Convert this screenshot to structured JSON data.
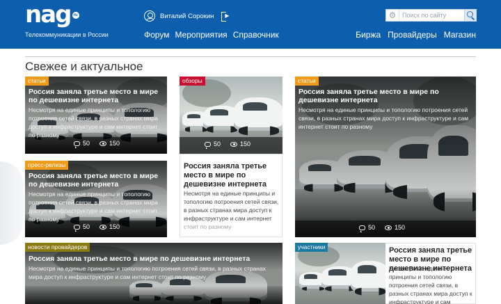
{
  "header": {
    "logo_text": "nag",
    "logo_badge": "ru",
    "tagline": "Телекоммуникации в России",
    "user_name": "Виталий Сорокин",
    "nav_left": [
      "Форум",
      "Мероприятия",
      "Справочник"
    ],
    "nav_right": [
      "Биржа",
      "Провайдеры",
      "Магазин"
    ],
    "search_placeholder": "Поиск по сайту",
    "icons": {
      "user": "user-icon",
      "logout": "logout-icon",
      "settings": "gear-icon",
      "search": "search-icon"
    }
  },
  "section": {
    "title": "Свежее и актуальное"
  },
  "colors": {
    "header_bg": "#0d5fae",
    "tag_articles": "#f09a1a",
    "tag_reviews": "#c8102e",
    "tag_press": "#f09a1a",
    "tag_provider_news": "#8a7a12",
    "tag_participants": "#1a7aa0"
  },
  "cards": [
    {
      "tag": "статьи",
      "title": "Россия заняла третье место в мире по дешевизне интернета",
      "text": "Несмотря на единые принципы и топологию потроения сетей связи, в разных странах мира доступ к инфраструктуре и сам интернет стоит по разному",
      "comments": "50",
      "views": "150"
    },
    {
      "tag": "обзоры",
      "title": "Россия заняла третье место в мире по дешевизне интернета",
      "text": "Несмотря на единые принципы и топологию потроения сетей связи, в разных странах мира доступ к инфраструктуре и сам интернет стоит по разному",
      "comments": "50",
      "views": "150"
    },
    {
      "tag": "статьи",
      "title": "Россия заняла третье место в мире по дешевизне интернета",
      "text": "Несмотря на единые принципы и топологию потроения сетей связи, в разных странах мира доступ к инфраструктуре и сам интернет стоит по разному",
      "comments": "50",
      "views": "150"
    },
    {
      "tag": "пресс-релизы",
      "title": "Россия заняла третье место в мире по дешевизне интернета",
      "text": "Несмотря на единые принципы и топологию потроения сетей связи, в разных странах мира доступ к инфраструктуре и сам интернет стоит по разному",
      "comments": "50",
      "views": "150"
    },
    {
      "tag": "новости провайдеров",
      "title": "Россия заняла третье место в мире по дешевизне интернета",
      "text": "Несмотря на единые принципы и топологию потроения сетей связи, в разных странах мира доступ к инфраструктуре и сам интернет стоит по разному"
    },
    {
      "tag": "участники",
      "title": "Россия заняла третье место в мире по дешевизне интернета",
      "text": "Несмотря на единые принципы и топологию потроения сетей связи, в разных странах мира доступ к инфраструктуре и сам интернет стоит по разному"
    }
  ]
}
